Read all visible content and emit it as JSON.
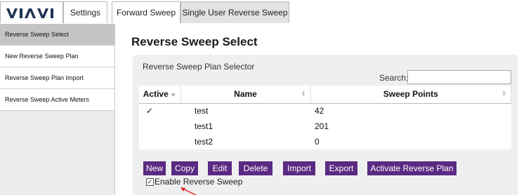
{
  "brand": {
    "logo_text": "VIAVI"
  },
  "tabs": [
    {
      "label": "Settings"
    },
    {
      "label": "Forward Sweep"
    },
    {
      "label": "Single User Reverse Sweep"
    }
  ],
  "sidebar": {
    "items": [
      {
        "label": "Reverse Sweep Select"
      },
      {
        "label": "New Reverse Sweep Plan"
      },
      {
        "label": "Reverse Sweep Plan Import"
      },
      {
        "label": "Reverse Sweep Active Meters"
      }
    ]
  },
  "main": {
    "title": "Reverse Sweep Select",
    "card_title": "Reverse Sweep Plan Selector",
    "search": {
      "label": "Search:",
      "value": ""
    },
    "table": {
      "headers": {
        "active": "Active",
        "name": "Name",
        "points": "Sweep Points"
      },
      "rows": [
        {
          "active": "✓",
          "name": "test",
          "points": "42"
        },
        {
          "active": "",
          "name": "test1",
          "points": "201"
        },
        {
          "active": "",
          "name": "test2",
          "points": "0"
        }
      ]
    },
    "buttons": {
      "new": "New",
      "copy": "Copy",
      "edit": "Edit",
      "delete": "Delete",
      "import": "Import",
      "export": "Export",
      "activate": "Activate Reverse Plan"
    },
    "enable": {
      "label": "Enable Reverse Sweep",
      "checked": true,
      "check_glyph": "✓"
    }
  },
  "colors": {
    "accent": "#5b2a83",
    "annotation_arrow": "#e02020"
  }
}
